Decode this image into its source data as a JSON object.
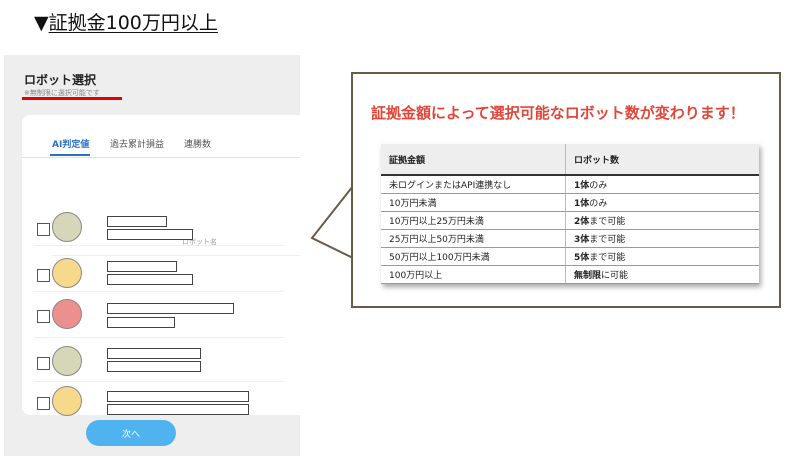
{
  "heading": {
    "prefix": "▼",
    "text": "証拠金100万円以上"
  },
  "phone": {
    "title": "ロボット選択",
    "note": "※無制限に選択可能です",
    "tabs": [
      "AI判定値",
      "過去累計損益",
      "連勝数"
    ],
    "column_header": "ロボット名",
    "rows": [
      {
        "avatar_color": "#d6d6b8"
      },
      {
        "avatar_color": "#f7d98b"
      },
      {
        "avatar_color": "#ec8f8f"
      },
      {
        "avatar_color": "#d6d6b8"
      },
      {
        "avatar_color": "#f7d98b"
      }
    ],
    "next_button": "次へ"
  },
  "bubble": {
    "title": "証拠金額によって選択可能なロボット数が変わります！",
    "table": {
      "headers": [
        "証拠金額",
        "ロボット数"
      ],
      "rows": [
        {
          "amount": "未ログインまたはAPI連携なし",
          "count_bold": "1体",
          "count_rest": "のみ"
        },
        {
          "amount": "10万円未満",
          "count_bold": "1体",
          "count_rest": "のみ"
        },
        {
          "amount": "10万円以上25万円未満",
          "count_bold": "2体",
          "count_rest": "まで可能"
        },
        {
          "amount": "25万円以上50万円未満",
          "count_bold": "3体",
          "count_rest": "まで可能"
        },
        {
          "amount": "50万円以上100万円未満",
          "count_bold": "5体",
          "count_rest": "まで可能"
        },
        {
          "amount": "100万円以上",
          "count_bold": "無制限",
          "count_rest": "に可能"
        }
      ]
    }
  },
  "colors": {
    "accent_red": "#e60000",
    "tab_blue": "#2a6fc9",
    "button_blue": "#4fb3f0",
    "title_red": "#e0463a"
  }
}
